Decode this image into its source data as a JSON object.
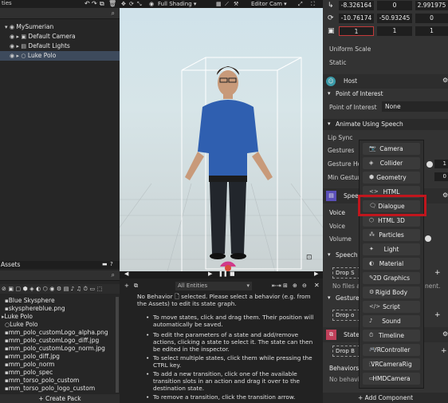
{
  "left": {
    "shading": "Full Shading",
    "hierarchy": [
      {
        "label": "MySumerian",
        "indent": 8
      },
      {
        "label": "Default Camera",
        "indent": 14
      },
      {
        "label": "Default Lights",
        "indent": 14
      },
      {
        "label": "Luke Polo",
        "indent": 14
      }
    ],
    "assets_title": "Assets",
    "assets": [
      {
        "label": "Blue Skysphere",
        "indent": 6
      },
      {
        "label": "skysphereblue.png",
        "indent": 6
      },
      {
        "label": "Luke Polo",
        "indent": 2
      },
      {
        "label": "Luke Polo",
        "indent": 6
      },
      {
        "label": "mm_polo_customLogo_alpha.png",
        "indent": 6
      },
      {
        "label": "mm_polo_customLogo_diff.jpg",
        "indent": 6
      },
      {
        "label": "mm_polo_customLogo_norm.jpg",
        "indent": 6
      },
      {
        "label": "mm_polo_diff.jpg",
        "indent": 6
      },
      {
        "label": "mm_polo_norm",
        "indent": 6
      },
      {
        "label": "mm_polo_spec",
        "indent": 6
      },
      {
        "label": "mm_torso_polo_custom",
        "indent": 6
      },
      {
        "label": "mm_torso_polo_logo_custom",
        "indent": 6
      }
    ],
    "create_pack": "+ Create Pack"
  },
  "viewport": {
    "camera": "Editor Cam"
  },
  "state_panel": {
    "filter": "All Entities",
    "intro": "No Behavior 🗋 selected. Please select a behavior (e.g. from the Assets) to edit its state graph.",
    "bullets": [
      "To move states, click and drag them. Their position will automatically be saved.",
      "To edit the parameters of a state and add/remove actions, clicking a state to select it. The state can then be edited in the inspector.",
      "To select multiple states, click them while pressing the CTRL key.",
      "To add a new transition, click one of the available transition slots in an action and drag it over to the destination state.",
      "To remove a transition, click the transition arrow."
    ]
  },
  "inspector": {
    "transform": [
      [
        "-8.326164",
        "0",
        "2.991975"
      ],
      [
        "-10.76174",
        "-50.93245",
        "0"
      ],
      [
        "1",
        "1",
        "1"
      ]
    ],
    "uniform_scale": "Uniform Scale",
    "static": "Static",
    "host": "Host",
    "poi_section": "Point of Interest",
    "poi_label": "Point of Interest",
    "poi_value": "None",
    "anim_section": "Animate Using Speech",
    "lip_sync": "Lip Sync",
    "gestures": "Gestures",
    "gesture_ho": "Gesture Ho",
    "min_gesture": "Min Gestur",
    "speech_partial": "Speec",
    "voice_head": "Voice",
    "voice": "Voice",
    "volume": "Volume",
    "speech_r": "Speech R",
    "drop_s": "Drop S",
    "no_files": "No files add",
    "no_files_tail": "nent.",
    "gesture_m": "Gesture",
    "drop_o": "Drop o",
    "state_m": "State",
    "drop_b": "Drop B",
    "behaviors": "Behaviors",
    "no_behavio": "No behavio",
    "add_component": "+ Add Component"
  },
  "menu": [
    {
      "label": "Camera",
      "icon": "camera-icon",
      "glyph": "📷"
    },
    {
      "label": "Collider",
      "icon": "collider-icon",
      "glyph": "◈"
    },
    {
      "label": "Geometry",
      "icon": "geometry-icon",
      "glyph": "⬢"
    },
    {
      "label": "HTML",
      "icon": "html-icon",
      "glyph": "<>"
    },
    {
      "label": "Dialogue",
      "icon": "dialogue-icon",
      "glyph": "🗨"
    },
    {
      "label": "HTML 3D",
      "icon": "html3d-icon",
      "glyph": "⬡"
    },
    {
      "label": "Particles",
      "icon": "particles-icon",
      "glyph": "⁂"
    },
    {
      "label": "Light",
      "icon": "light-icon",
      "glyph": "✦"
    },
    {
      "label": "Material",
      "icon": "material-icon",
      "glyph": "◐"
    },
    {
      "label": "2D Graphics",
      "icon": "graphics2d-icon",
      "glyph": "✎"
    },
    {
      "label": "Rigid Body",
      "icon": "rigidbody-icon",
      "glyph": "⚙"
    },
    {
      "label": "Script",
      "icon": "script-icon",
      "glyph": "</>"
    },
    {
      "label": "Sound",
      "icon": "sound-icon",
      "glyph": "♪"
    },
    {
      "label": "Timeline",
      "icon": "timeline-icon",
      "glyph": "⏱"
    },
    {
      "label": "VRController",
      "icon": "vrcontroller-icon",
      "glyph": "🎮"
    },
    {
      "label": "VRCameraRig",
      "icon": "vrcamerarig-icon",
      "glyph": "⬚"
    },
    {
      "label": "HMDCamera",
      "icon": "hmdcamera-icon",
      "glyph": "▭"
    }
  ],
  "colors": {
    "highlight": "#c0161d",
    "accent": "#3a63a8",
    "selection": "#3d4a5c"
  }
}
